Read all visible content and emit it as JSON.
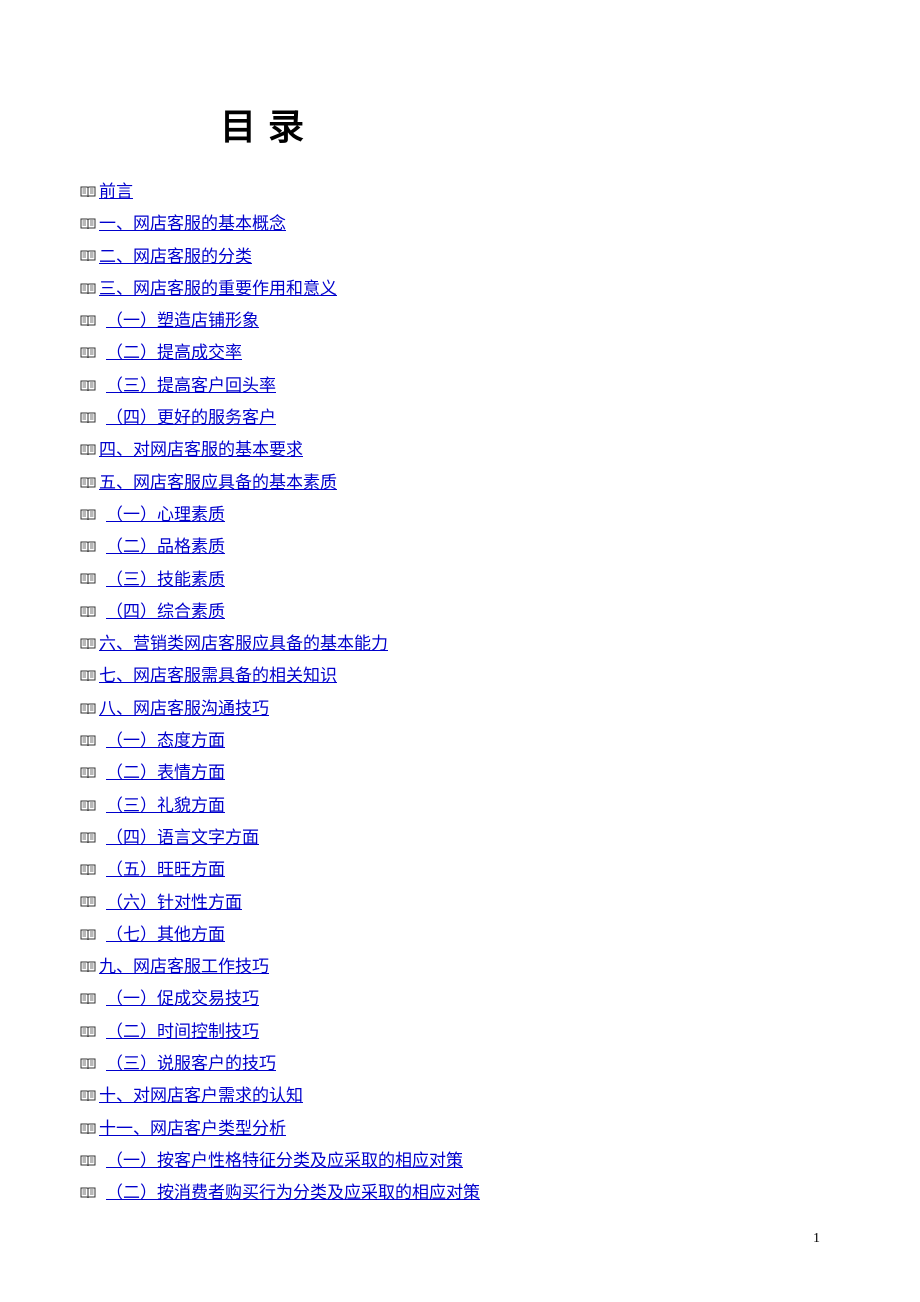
{
  "title": "目录",
  "page_number": "1",
  "toc": [
    {
      "text": "前言",
      "indent": false
    },
    {
      "text": "一、网店客服的基本概念",
      "indent": false
    },
    {
      "text": "二、网店客服的分类",
      "indent": false
    },
    {
      "text": "三、网店客服的重要作用和意义",
      "indent": false
    },
    {
      "text": "（一）塑造店铺形象",
      "indent": true
    },
    {
      "text": "（二）提高成交率",
      "indent": true
    },
    {
      "text": "（三）提高客户回头率",
      "indent": true
    },
    {
      "text": "（四）更好的服务客户",
      "indent": true
    },
    {
      "text": "四、对网店客服的基本要求",
      "indent": false
    },
    {
      "text": "五、网店客服应具备的基本素质",
      "indent": false
    },
    {
      "text": "（一）心理素质",
      "indent": true
    },
    {
      "text": "（二）品格素质",
      "indent": true
    },
    {
      "text": "（三）技能素质",
      "indent": true
    },
    {
      "text": "（四）综合素质",
      "indent": true
    },
    {
      "text": "六、营销类网店客服应具备的基本能力",
      "indent": false
    },
    {
      "text": "七、网店客服需具备的相关知识",
      "indent": false
    },
    {
      "text": "八、网店客服沟通技巧",
      "indent": false
    },
    {
      "text": "（一）态度方面",
      "indent": true
    },
    {
      "text": "（二）表情方面",
      "indent": true
    },
    {
      "text": "（三）礼貌方面",
      "indent": true
    },
    {
      "text": "（四）语言文字方面",
      "indent": true
    },
    {
      "text": "（五）旺旺方面",
      "indent": true
    },
    {
      "text": "（六）针对性方面",
      "indent": true
    },
    {
      "text": "（七）其他方面",
      "indent": true
    },
    {
      "text": "九、网店客服工作技巧",
      "indent": false
    },
    {
      "text": "（一）促成交易技巧",
      "indent": true
    },
    {
      "text": "（二）时间控制技巧",
      "indent": true
    },
    {
      "text": "（三）说服客户的技巧",
      "indent": true
    },
    {
      "text": "十、对网店客户需求的认知",
      "indent": false
    },
    {
      "text": "十一、网店客户类型分析",
      "indent": false
    },
    {
      "text": "（一）按客户性格特征分类及应采取的相应对策",
      "indent": true
    },
    {
      "text": "（二）按消费者购买行为分类及应采取的相应对策",
      "indent": true
    }
  ]
}
